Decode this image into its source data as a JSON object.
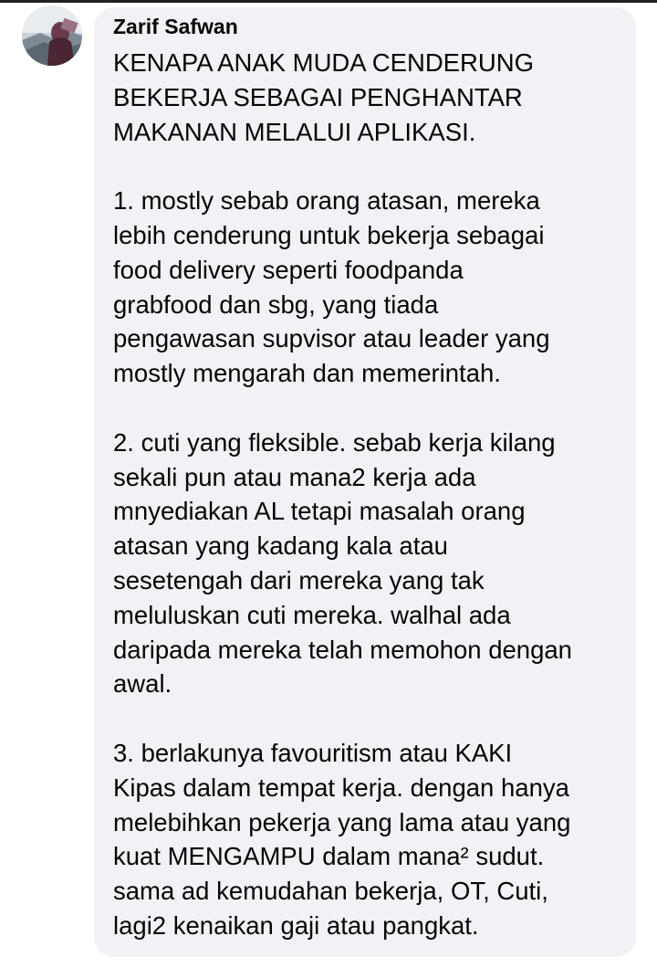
{
  "comment": {
    "author": "Zarif Safwan",
    "paragraphs": [
      [
        "KENAPA ANAK MUDA CENDERUNG",
        "BEKERJA SEBAGAI PENGHANTAR",
        "MAKANAN MELALUI APLIKASI."
      ],
      [
        "1. mostly sebab orang atasan, mereka",
        "lebih cenderung untuk bekerja sebagai",
        "food delivery seperti foodpanda",
        "grabfood dan sbg, yang tiada",
        "pengawasan supvisor atau leader yang",
        "mostly mengarah dan memerintah."
      ],
      [
        "2. cuti yang fleksible. sebab kerja kilang",
        "sekali pun atau mana2 kerja ada",
        "mnyediakan AL tetapi masalah orang",
        "atasan yang kadang kala atau",
        "sesetengah dari mereka yang tak",
        "meluluskan cuti mereka. walhal ada",
        "daripada mereka telah memohon dengan",
        "awal."
      ],
      [
        "3. berlakunya favouritism atau KAKI",
        "Kipas dalam tempat kerja. dengan hanya",
        "melebihkan pekerja yang lama atau yang",
        "kuat MENGAMPU dalam mana² sudut.",
        "sama ad kemudahan bekerja, OT, Cuti,",
        "lagi2 kenaikan gaji atau pangkat."
      ]
    ]
  }
}
